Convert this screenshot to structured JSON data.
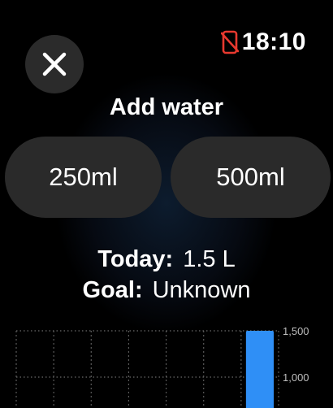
{
  "status": {
    "time": "18:10",
    "icon": "phone-disconnected-icon",
    "icon_color": "#e8392f"
  },
  "close": {
    "icon": "close-icon"
  },
  "title": "Add water",
  "buttons": [
    {
      "label": "250ml"
    },
    {
      "label": "500ml"
    }
  ],
  "stats": {
    "today_label": "Today:",
    "today_value": "1.5 L",
    "goal_label": "Goal:",
    "goal_value": "Unknown"
  },
  "chart_data": {
    "type": "bar",
    "values": [
      0,
      0,
      0,
      0,
      0,
      0,
      1500
    ],
    "y_ticks": [
      "1,500",
      "1,000"
    ],
    "y_tick_values": [
      1500,
      1000
    ],
    "bar_color": "#2f8ff6",
    "grid": "dotted"
  }
}
